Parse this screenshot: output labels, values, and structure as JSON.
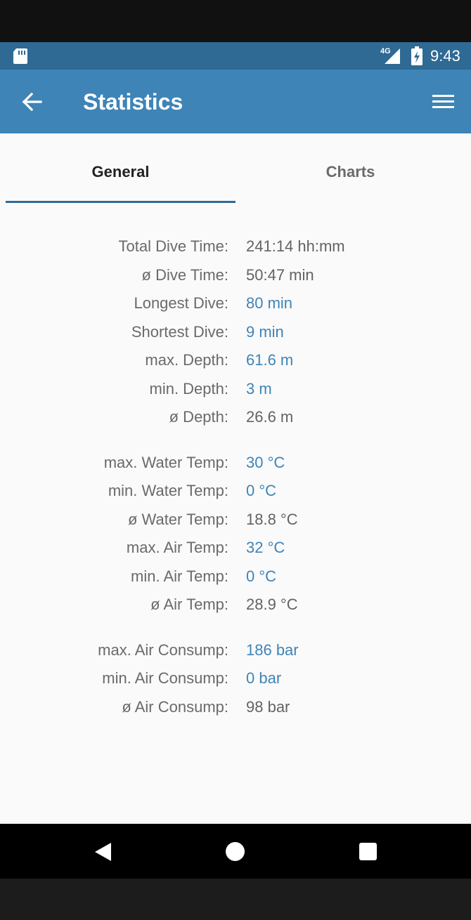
{
  "status_bar": {
    "time": "9:43",
    "network": "4G",
    "icons": [
      "sd-card-icon",
      "signal-icon",
      "battery-icon"
    ]
  },
  "app_bar": {
    "title": "Statistics",
    "back_icon": "arrow-left-icon",
    "menu_icon": "hamburger-menu-icon"
  },
  "tabs": [
    {
      "label": "General",
      "selected": true
    },
    {
      "label": "Charts",
      "selected": false
    }
  ],
  "colors": {
    "status_bar": "#2f6a94",
    "app_bar": "#3e84b7",
    "highlight_value": "#3e84b7",
    "tab_indicator": "#2f6a94"
  },
  "stats": {
    "depth_time": [
      {
        "label": "Total Dive Time:",
        "value": "241:14 hh:mm",
        "highlight": false
      },
      {
        "label": "ø Dive Time:",
        "value": "50:47 min",
        "highlight": false
      },
      {
        "label": "Longest Dive:",
        "value": "80 min",
        "highlight": true
      },
      {
        "label": "Shortest Dive:",
        "value": "9 min",
        "highlight": true
      },
      {
        "label": "max. Depth:",
        "value": "61.6 m",
        "highlight": true
      },
      {
        "label": "min. Depth:",
        "value": "3 m",
        "highlight": true
      },
      {
        "label": "ø Depth:",
        "value": "26.6 m",
        "highlight": false
      }
    ],
    "temperature": [
      {
        "label": "max. Water Temp:",
        "value": "30 °C",
        "highlight": true
      },
      {
        "label": "min. Water Temp:",
        "value": "0 °C",
        "highlight": true
      },
      {
        "label": "ø Water Temp:",
        "value": "18.8 °C",
        "highlight": false
      },
      {
        "label": "max. Air Temp:",
        "value": "32 °C",
        "highlight": true
      },
      {
        "label": "min. Air Temp:",
        "value": "0 °C",
        "highlight": true
      },
      {
        "label": "ø Air Temp:",
        "value": "28.9 °C",
        "highlight": false
      }
    ],
    "air": [
      {
        "label": "max. Air Consump:",
        "value": "186 bar",
        "highlight": true
      },
      {
        "label": "min. Air Consump:",
        "value": "0 bar",
        "highlight": true
      },
      {
        "label": "ø Air Consump:",
        "value": "98 bar",
        "highlight": false
      }
    ]
  },
  "nav_bar": {
    "icons": [
      "nav-back-icon",
      "nav-home-icon",
      "nav-recents-icon"
    ]
  }
}
